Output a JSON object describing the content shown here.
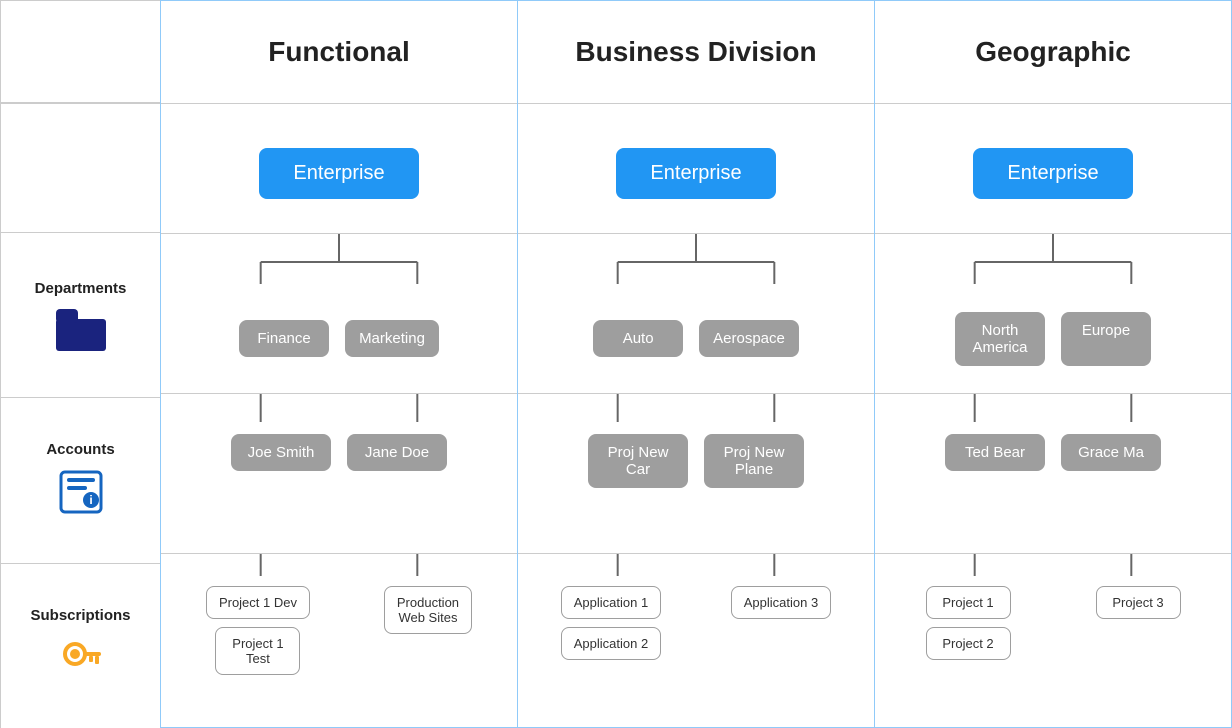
{
  "columns": [
    {
      "id": "functional",
      "header": "Functional",
      "enterprise": "Enterprise",
      "departments": [
        "Finance",
        "Marketing"
      ],
      "accounts": [
        "Joe Smith",
        "Jane Doe"
      ],
      "subscriptions": [
        {
          "parent": "Joe Smith",
          "items": [
            "Project 1 Dev",
            "Project 1 Test"
          ]
        },
        {
          "parent": "Jane Doe",
          "items": [
            "Production Web Sites"
          ]
        }
      ]
    },
    {
      "id": "business",
      "header": "Business Division",
      "enterprise": "Enterprise",
      "departments": [
        "Auto",
        "Aerospace"
      ],
      "accounts": [
        "Proj New Car",
        "Proj New Plane"
      ],
      "subscriptions": [
        {
          "parent": "Proj New Car",
          "items": [
            "Application 1",
            "Application 2"
          ]
        },
        {
          "parent": "Proj New Plane",
          "items": [
            "Application 3"
          ]
        }
      ]
    },
    {
      "id": "geographic",
      "header": "Geographic",
      "enterprise": "Enterprise",
      "departments": [
        "North America",
        "Europe"
      ],
      "accounts": [
        "Ted Bear",
        "Grace Ma"
      ],
      "subscriptions": [
        {
          "parent": "Ted Bear",
          "items": [
            "Project 1",
            "Project 2"
          ]
        },
        {
          "parent": "Grace Ma",
          "items": [
            "Project 3"
          ]
        }
      ]
    }
  ],
  "labels": {
    "departments": "Departments",
    "accounts": "Accounts",
    "subscriptions": "Subscriptions"
  }
}
